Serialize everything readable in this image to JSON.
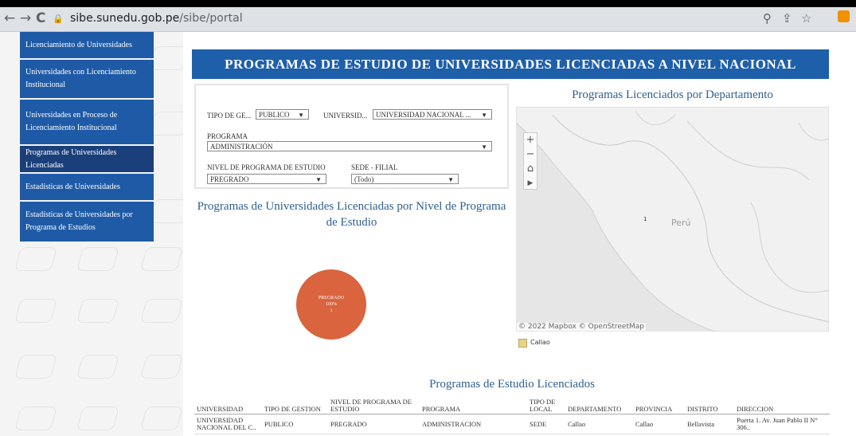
{
  "browser": {
    "url_domain": "sibe.sunedu.gob.pe",
    "url_path": "/sibe/portal",
    "back_icon": "←",
    "forward_icon": "→",
    "reload_icon": "C"
  },
  "sidebar": {
    "items": [
      {
        "label": "Licenciamiento de Universidades"
      },
      {
        "label": "Universidades con Licenciamiento Institucional"
      },
      {
        "label": "Universidades en Proceso de Licenciamiento Institucional"
      },
      {
        "label": "Programas de Universidades Licenciadas"
      },
      {
        "label": "Estadísticas de Universidades"
      },
      {
        "label": "Estadísticas de Universidades por Programa de Estudios"
      }
    ]
  },
  "main": {
    "title": "PROGRAMAS DE ESTUDIO DE UNIVERSIDADES LICENCIADAS A NIVEL NACIONAL"
  },
  "filters": {
    "tipo_gestion": {
      "label": "TIPO DE GE...",
      "value": "PUBLICO"
    },
    "universidad": {
      "label": "UNIVERSID...",
      "value": "UNIVERSIDAD NACIONAL ..."
    },
    "programa": {
      "label": "PROGRAMA",
      "value": "ADMINISTRACIÓN"
    },
    "nivel": {
      "label": "NIVEL DE PROGRAMA DE ESTUDIO",
      "value": "PREGRADO"
    },
    "sede": {
      "label": "SEDE - FILIAL",
      "value": "(Todo)"
    }
  },
  "map": {
    "title": "Programas Licenciados por Departamento",
    "country_label": "Perú",
    "marker_label": "1",
    "copyright": "© 2022 Mapbox  © OpenStreetMap",
    "legend": "Callao",
    "colors": {
      "legend": "#e8d38a"
    }
  },
  "pie": {
    "title": "Programas de Universidades Licenciadas por Nivel de Programa de Estudio",
    "slice_label": "PREGRADO",
    "slice_percent": "100%",
    "slice_count": "1",
    "color": "#d9643e"
  },
  "chart_data": {
    "type": "pie",
    "title": "Programas de Universidades Licenciadas por Nivel de Programa de Estudio",
    "categories": [
      "PREGRADO"
    ],
    "values": [
      1
    ],
    "percent": [
      100
    ]
  },
  "table": {
    "title": "Programas de Estudio Licenciados",
    "headers": [
      "UNIVERSIDAD",
      "TIPO DE GESTION",
      "NIVEL DE PROGRAMA DE ESTUDIO",
      "PROGRAMA",
      "TIPO DE LOCAL",
      "DEPARTAMENTO",
      "PROVINCIA",
      "DISTRITO",
      "DIRECCION"
    ],
    "rows": [
      [
        "UNIVERSIDAD NACIONAL DEL C..",
        "PUBLICO",
        "PREGRADO",
        "ADMINISTRACION",
        "SEDE",
        "Callao",
        "Callao",
        "Bellavista",
        "Puerta 1. Av. Juan Pablo II N° 306.."
      ]
    ]
  }
}
